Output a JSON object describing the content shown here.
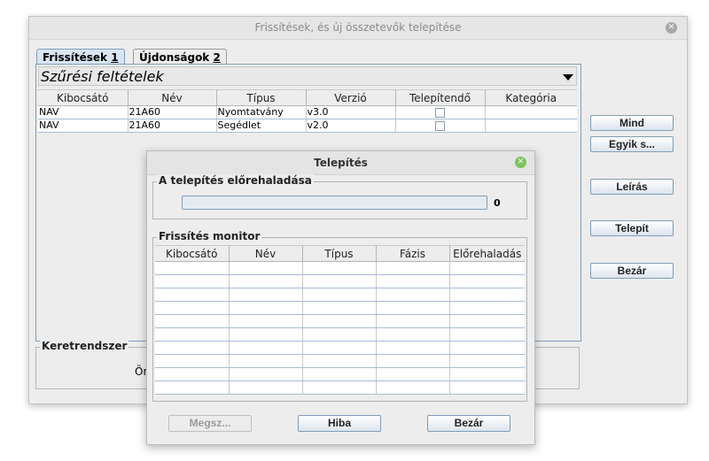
{
  "main_window": {
    "title": "Frissítések, és új összetevők telepítése",
    "close_glyph": "✕",
    "tabs": [
      {
        "label_pre": "Frissítések ",
        "label_key": "1"
      },
      {
        "label_pre": "Újdonságok ",
        "label_key": "2"
      }
    ],
    "filter": {
      "label": "Szűrési feltételek"
    },
    "table": {
      "columns": [
        "Kibocsátó",
        "Név",
        "Típus",
        "Verzió",
        "Telepítendő",
        "Kategória"
      ],
      "rows": [
        {
          "kibocsato": "NAV",
          "nev": "21A60",
          "tipus": "Nyomtatvány",
          "verzio": "v3.0",
          "kategoria": ""
        },
        {
          "kibocsato": "NAV",
          "nev": "21A60",
          "tipus": "Segédlet",
          "verzio": "v2.0",
          "kategoria": ""
        }
      ]
    },
    "buttons": {
      "mind": "Mind",
      "egyik": "Egyik s...",
      "leiras": "Leírás",
      "telepit": "Telepít",
      "bezar": "Bezár"
    },
    "framework": {
      "title": "Keretrendszer",
      "text_fragment": "Ön"
    }
  },
  "install_dialog": {
    "title": "Telepítés",
    "close_glyph": "✕",
    "progress_section": {
      "title": "A telepítés előrehaladása",
      "value": 0,
      "value_label": "0"
    },
    "monitor": {
      "title": "Frissítés monitor",
      "columns": [
        "Kibocsátó",
        "Név",
        "Típus",
        "Fázis",
        "Előrehaladás"
      ]
    },
    "buttons": {
      "cancel": "Megsz...",
      "error": "Hiba",
      "close": "Bezár"
    }
  }
}
